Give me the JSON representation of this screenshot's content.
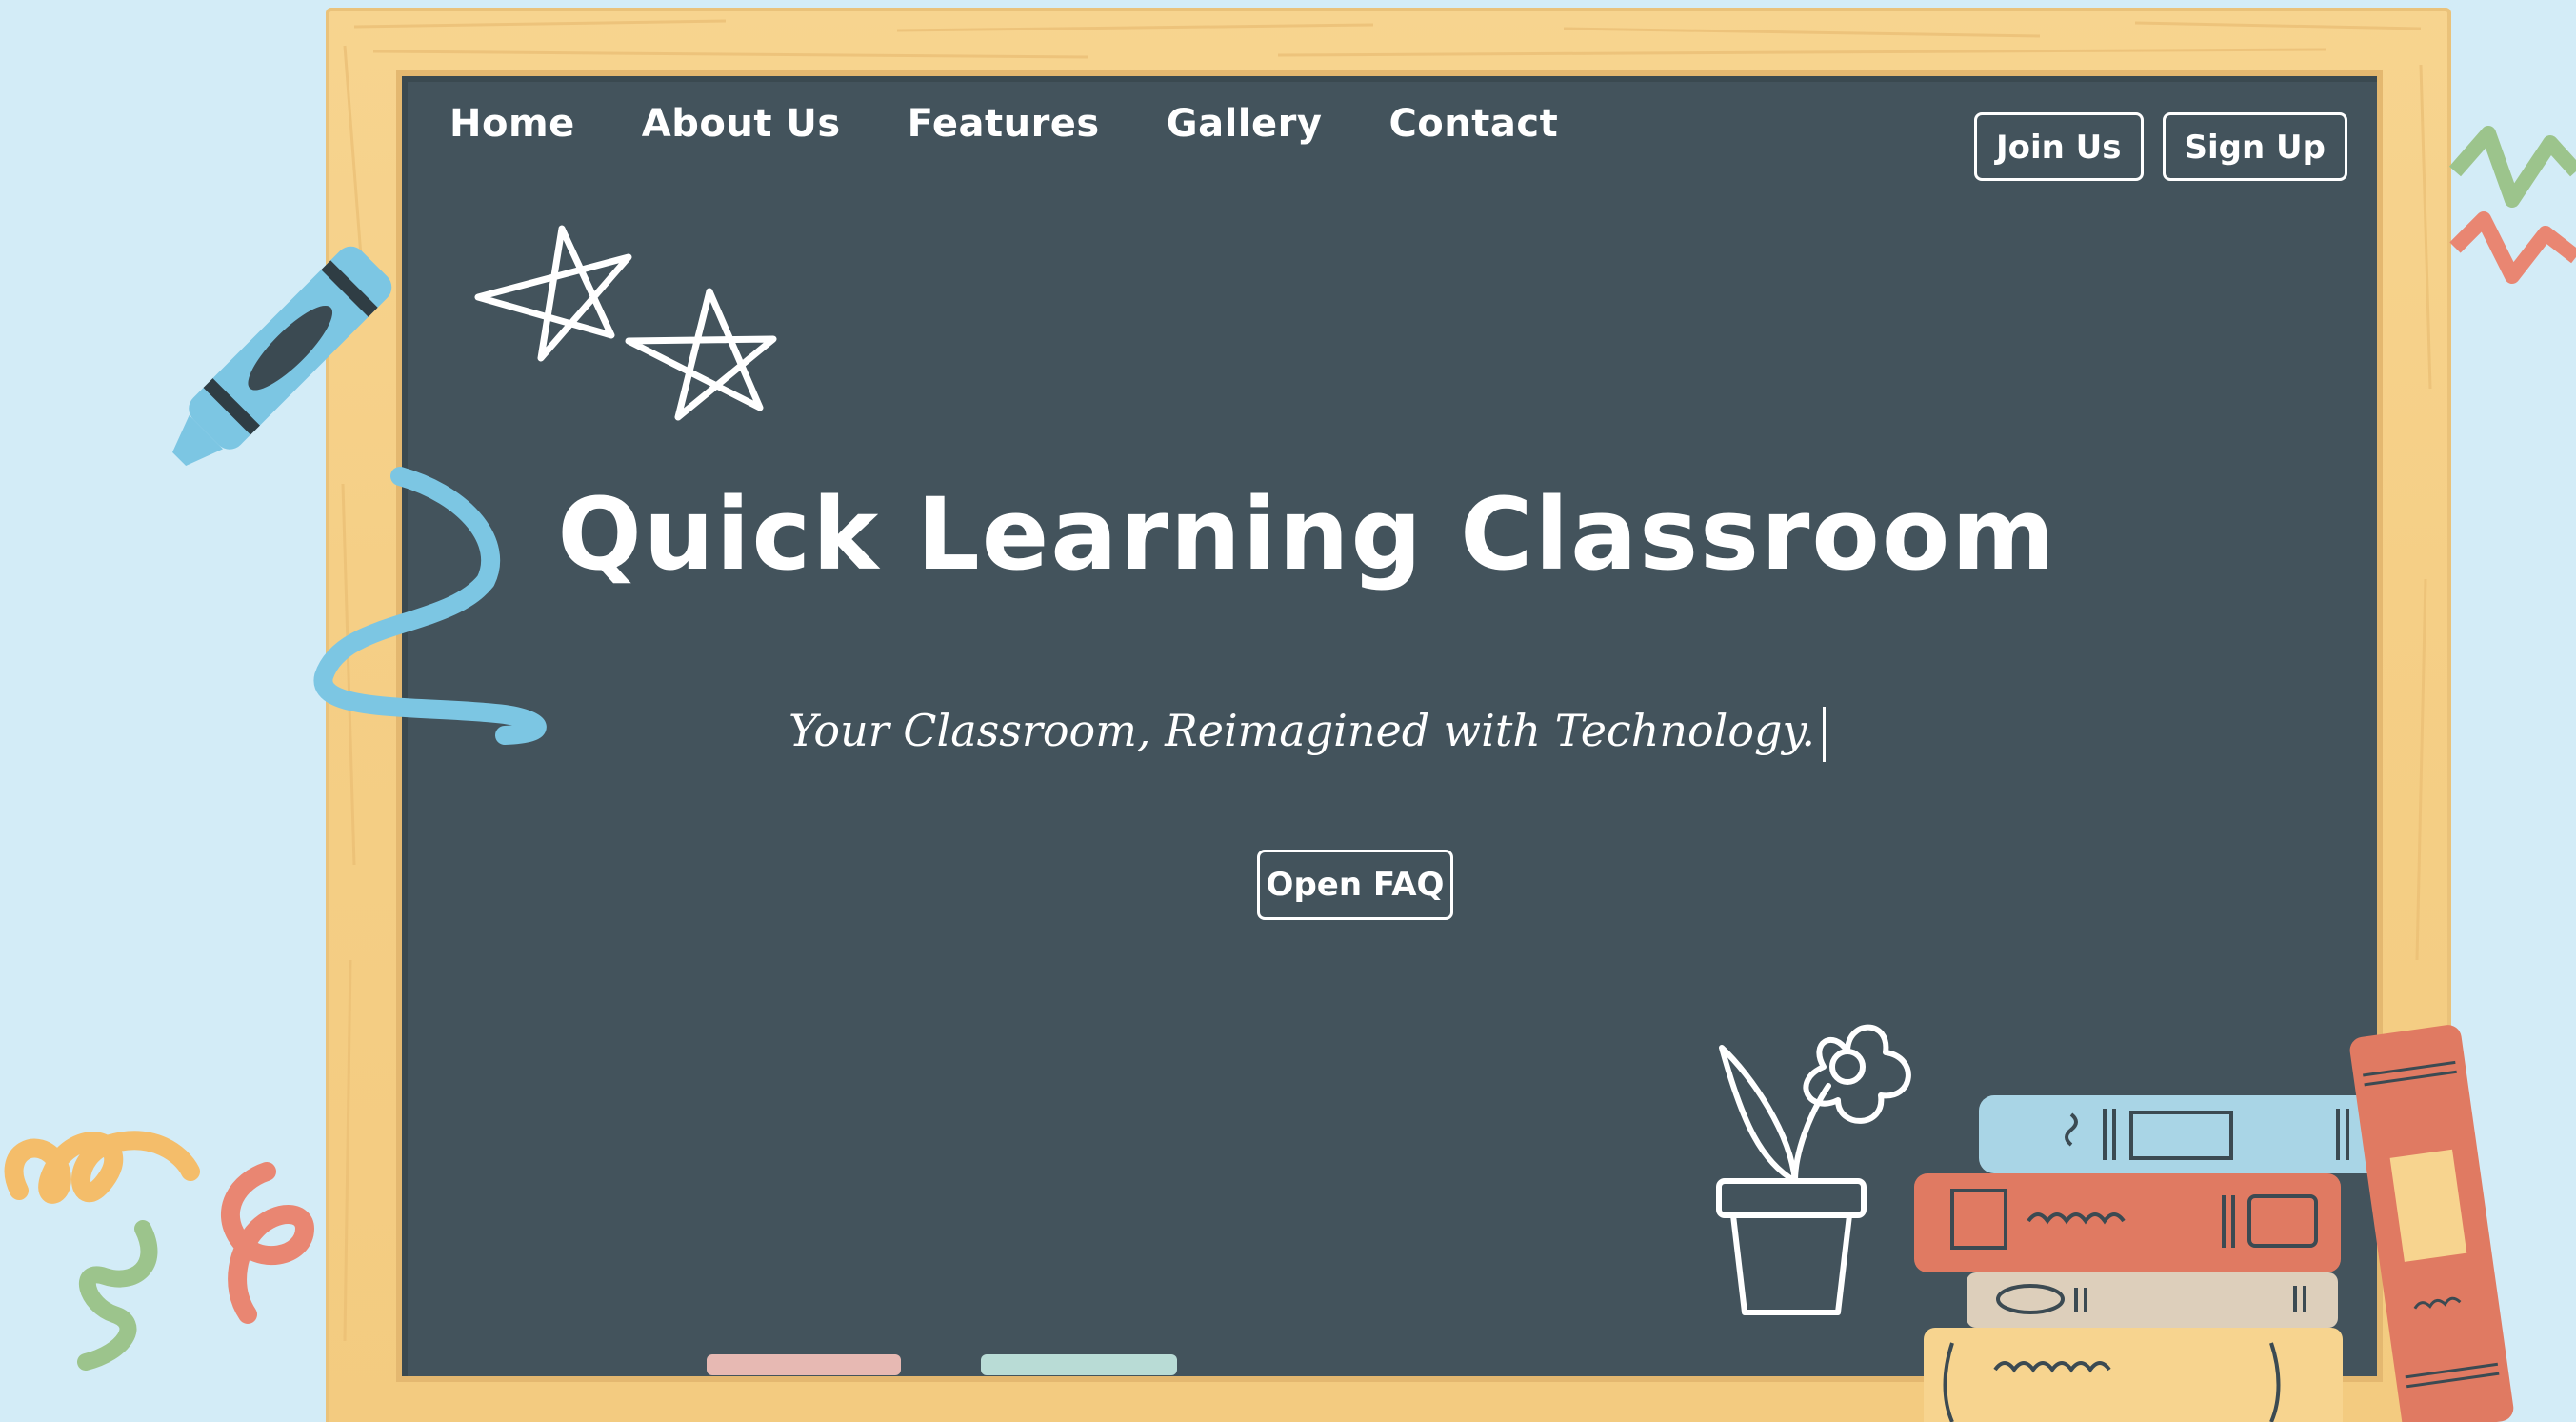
{
  "nav": {
    "items": [
      {
        "label": "Home"
      },
      {
        "label": "About Us"
      },
      {
        "label": "Features"
      },
      {
        "label": "Gallery"
      },
      {
        "label": "Contact"
      }
    ],
    "join_label": "Join Us",
    "signup_label": "Sign Up"
  },
  "hero": {
    "title": "Quick Learning Classroom",
    "subtitle": "Your Classroom, Reimagined with Technology.",
    "faq_label": "Open FAQ"
  },
  "colors": {
    "background": "#d3ecf7",
    "board": "#43535c",
    "frame": "#f5cf86",
    "chalk_pink": "#e7b9b3",
    "chalk_mint": "#b9dcd6",
    "crayon_blue": "#7cc6e3"
  },
  "icons": [
    "crayon-icon",
    "stars-icon",
    "flower-pot-icon",
    "books-stack-icon",
    "squiggle-icon"
  ]
}
